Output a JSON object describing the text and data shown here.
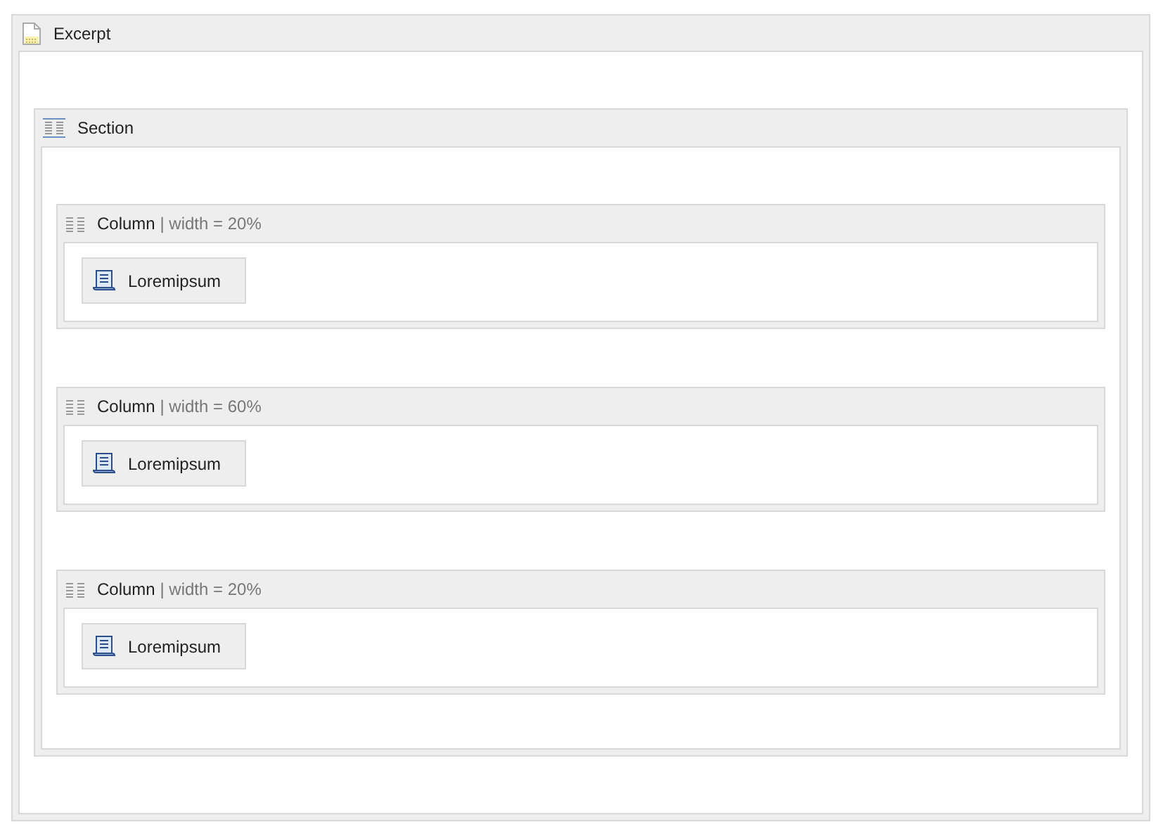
{
  "excerpt": {
    "title": "Excerpt",
    "section": {
      "title": "Section",
      "columns": [
        {
          "title": "Column",
          "detail": "| width = 20%",
          "items": [
            "Loremipsum"
          ]
        },
        {
          "title": "Column",
          "detail": "| width = 60%",
          "items": [
            "Loremipsum"
          ]
        },
        {
          "title": "Column",
          "detail": "| width = 20%",
          "items": [
            "Loremipsum"
          ]
        }
      ]
    }
  }
}
